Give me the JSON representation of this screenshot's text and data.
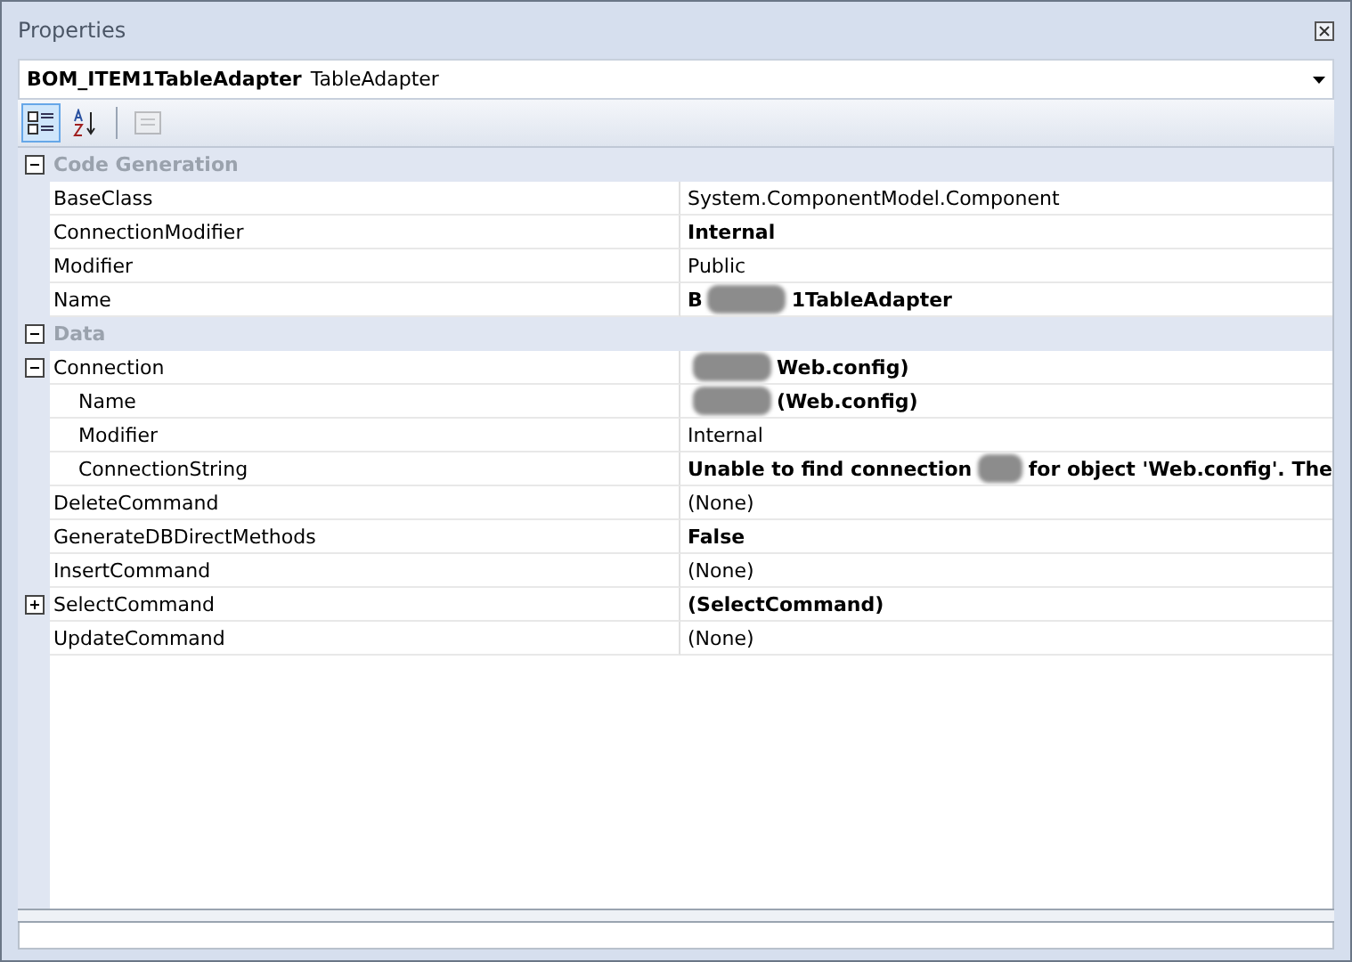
{
  "window": {
    "title": "Properties"
  },
  "object_selector": {
    "name": "BOM_ITEM1TableAdapter",
    "type": "TableAdapter"
  },
  "toolbar": [
    {
      "kind": "categorized",
      "selected": true,
      "disabled": false
    },
    {
      "kind": "alphabetical",
      "selected": false,
      "disabled": false
    },
    {
      "kind": "property-pages",
      "selected": false,
      "disabled": true
    }
  ],
  "grid": [
    {
      "kind": "category",
      "label": "Code Generation",
      "expanded": true,
      "children": [
        {
          "label": "BaseClass",
          "value": [
            {
              "kind": "text",
              "text": "System.ComponentModel.Component"
            }
          ],
          "bold": false
        },
        {
          "label": "ConnectionModifier",
          "value": [
            {
              "kind": "text",
              "text": "Internal"
            }
          ],
          "bold": true
        },
        {
          "label": "Modifier",
          "value": [
            {
              "kind": "text",
              "text": "Public"
            }
          ],
          "bold": false
        },
        {
          "label": "Name",
          "value": [
            {
              "kind": "text",
              "text": "B"
            },
            {
              "kind": "redaction"
            },
            {
              "kind": "text",
              "text": "1TableAdapter"
            }
          ],
          "bold": true
        }
      ]
    },
    {
      "kind": "category",
      "label": "Data",
      "expanded": true,
      "children": [
        {
          "label": "Connection",
          "value": [
            {
              "kind": "redaction"
            },
            {
              "kind": "text",
              "text": "Web.config)"
            }
          ],
          "bold": true,
          "expanded": true,
          "children": [
            {
              "label": "Name",
              "value": [
                {
                  "kind": "redaction"
                },
                {
                  "kind": "text",
                  "text": "(Web.config)"
                }
              ],
              "bold": true
            },
            {
              "label": "Modifier",
              "value": [
                {
                  "kind": "text",
                  "text": "Internal"
                }
              ],
              "bold": false
            },
            {
              "label": "ConnectionString",
              "value": [
                {
                  "kind": "text",
                  "text": "Unable to find connection"
                },
                {
                  "kind": "redaction"
                },
                {
                  "kind": "text",
                  "text": "for object 'Web.config'. The"
                }
              ],
              "bold": true
            }
          ]
        },
        {
          "label": "DeleteCommand",
          "value": [
            {
              "kind": "text",
              "text": "(None)"
            }
          ],
          "bold": false
        },
        {
          "label": "GenerateDBDirectMethods",
          "value": [
            {
              "kind": "text",
              "text": "False"
            }
          ],
          "bold": true
        },
        {
          "label": "InsertCommand",
          "value": [
            {
              "kind": "text",
              "text": "(None)"
            }
          ],
          "bold": false
        },
        {
          "label": "SelectCommand",
          "value": [
            {
              "kind": "text",
              "text": "(SelectCommand)"
            }
          ],
          "bold": true,
          "expanded": false
        },
        {
          "label": "UpdateCommand",
          "value": [
            {
              "kind": "text",
              "text": "(None)"
            }
          ],
          "bold": false
        }
      ]
    }
  ]
}
